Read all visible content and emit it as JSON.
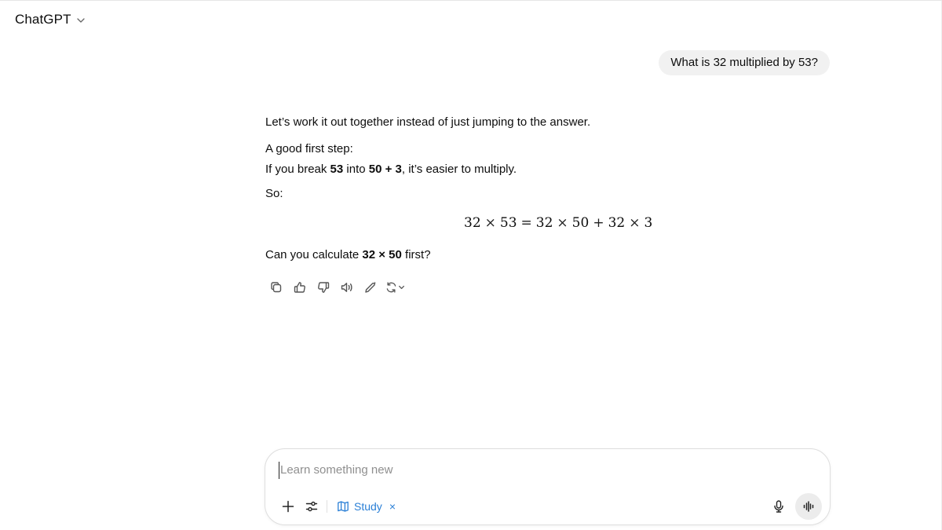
{
  "header": {
    "title": "ChatGPT",
    "chevron_icon": "chevron-down-icon"
  },
  "conversation": {
    "user_message": "What is 32 multiplied by 53?",
    "assistant": {
      "p1": "Let’s work it out together instead of just jumping to the answer.",
      "p2_line1": "A good first step:",
      "p2_line2_prefix": "If you break ",
      "p2_bold1": "53",
      "p2_mid": " into ",
      "p2_bold2": "50 + 3",
      "p2_suffix": ", it’s easier to multiply.",
      "p3": "So:",
      "math": {
        "a": "32",
        "times1": "×",
        "b": "53",
        "eq": "=",
        "c": "32",
        "times2": "×",
        "d": "50",
        "plus": "+",
        "e": "32",
        "times3": "×",
        "f": "3"
      },
      "p4_prefix": "Can you calculate ",
      "p4_bold": "32 × 50",
      "p4_suffix": " first?"
    },
    "actions": [
      "copy-icon",
      "thumbs-up-icon",
      "thumbs-down-icon",
      "read-aloud-icon",
      "edit-icon",
      "regenerate-icon"
    ]
  },
  "composer": {
    "placeholder": "Learn something new",
    "study_label": "Study",
    "study_close": "×",
    "icons": {
      "add": "plus-icon",
      "tools": "sliders-icon",
      "study": "book-icon",
      "mic": "mic-icon",
      "voice": "voice-wave-icon"
    },
    "accent_color": "#2a7fd6"
  }
}
